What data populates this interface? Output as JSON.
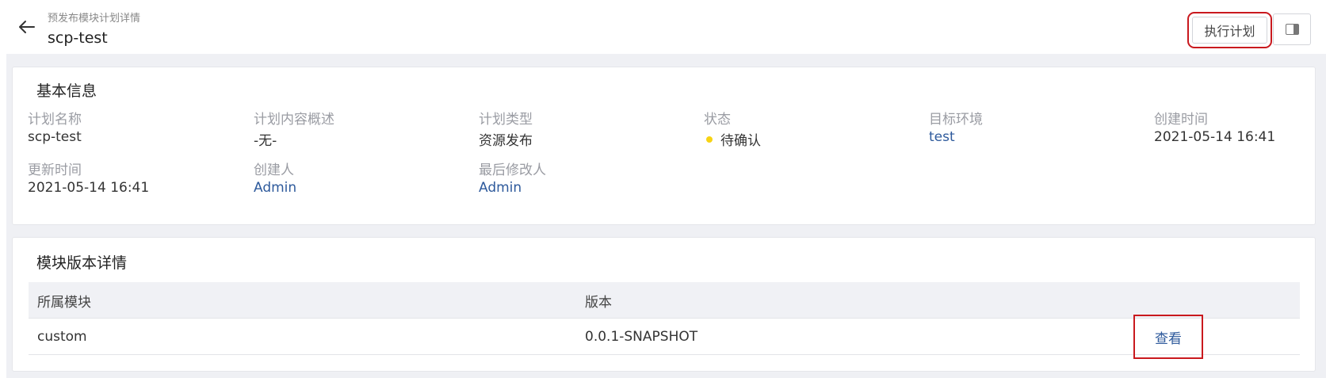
{
  "header": {
    "breadcrumb": "预发布模块计划详情",
    "title": "scp-test",
    "execute_label": "执行计划"
  },
  "basic_info": {
    "title": "基本信息",
    "fields": [
      {
        "label": "计划名称",
        "value": "scp-test"
      },
      {
        "label": "计划内容概述",
        "value": "-无-"
      },
      {
        "label": "计划类型",
        "value": "资源发布"
      },
      {
        "label": "状态",
        "value": "待确认"
      },
      {
        "label": "目标环境",
        "value": "test"
      },
      {
        "label": "创建时间",
        "value": "2021-05-14 16:41"
      },
      {
        "label": "更新时间",
        "value": "2021-05-14 16:41"
      },
      {
        "label": "创建人",
        "value": "Admin"
      },
      {
        "label": "最后修改人",
        "value": "Admin"
      }
    ],
    "status_color": "#f7d313"
  },
  "modules": {
    "title": "模块版本详情",
    "columns": [
      "所属模块",
      "版本"
    ],
    "rows": [
      {
        "module": "custom",
        "version": "0.0.1-SNAPSHOT",
        "action": "查看"
      }
    ]
  },
  "colors": {
    "link": "#2e5a9c",
    "highlight_border": "#c9191e",
    "page_bg": "#eff0f4"
  }
}
